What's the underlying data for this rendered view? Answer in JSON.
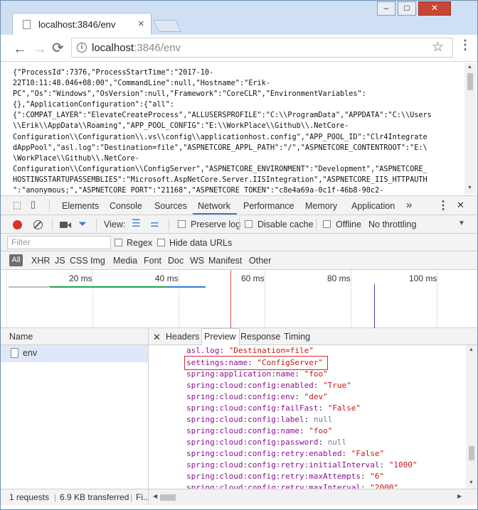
{
  "browser": {
    "tab_title": "localhost:3846/env",
    "tab_close": "×",
    "window_buttons": {
      "minimize": "–",
      "maximize": "□",
      "close": "✕"
    }
  },
  "toolbar": {
    "back": "←",
    "forward": "→",
    "reload": "⟳",
    "url_host": "localhost",
    "url_rest": ":3846/env",
    "star": "☆",
    "menu": "⋮"
  },
  "page": {
    "lines": [
      "{\"ProcessId\":7376,\"ProcessStartTime\":\"2017-10-",
      "22T10:11:48.046+08:00\",\"CommandLine\":null,\"Hostname\":\"Erik-",
      "PC\",\"Os\":\"Windows\",\"OsVersion\":null,\"Framework\":\"CoreCLR\",\"EnvironmentVariables\":",
      "{},\"ApplicationConfiguration\":{\"all\":",
      "{\":COMPAT_LAYER\":\"ElevateCreateProcess\",\"ALLUSERSPROFILE\":\"C:\\\\ProgramData\",\"APPDATA\":\"C:\\\\Users",
      "\\\\Erik\\\\AppData\\\\Roaming\",\"APP_POOL_CONFIG\":\"E:\\\\WorkPlace\\\\Github\\\\.NetCore-",
      "Configuration\\\\Configuration\\\\.vs\\\\config\\\\applicationhost.config\",\"APP_POOL_ID\":\"Clr4Integrate",
      "dAppPool\",\"asl.log\":\"Destination=file\",\"ASPNETCORE_APPL_PATH\":\"/\",\"ASPNETCORE_CONTENTROOT\":\"E:\\",
      "\\WorkPlace\\\\Github\\\\.NetCore-",
      "Configuration\\\\Configuration\\\\ConfigServer\",\"ASPNETCORE_ENVIRONMENT\":\"Development\",\"ASPNETCORE_",
      "HOSTINGSTARTUPASSEMBLIES\":\"Microsoft.AspNetCore.Server.IISIntegration\",\"ASPNETCORE_IIS_HTTPAUTH",
      "\":\"anonymous;\",\"ASPNETCORE_PORT\":\"21168\",\"ASPNETCORE_TOKEN\":\"c8e4a69a-0c1f-46b8-90c2-"
    ]
  },
  "devtools": {
    "tabs": [
      "Elements",
      "Console",
      "Sources",
      "Network",
      "Performance",
      "Memory",
      "Application"
    ],
    "active_tab": "Network",
    "more": "»",
    "kebab": "⋮",
    "close": "✕",
    "network_toolbar": {
      "view_label": "View:",
      "preserve_log": "Preserve log",
      "disable_cache": "Disable cache",
      "offline": "Offline",
      "throttling": "No throttling"
    },
    "filter": {
      "placeholder": "Filter",
      "regex": "Regex",
      "hide_data_urls": "Hide data URLs"
    },
    "type_filters": [
      "All",
      "XHR",
      "JS",
      "CSS",
      "Img",
      "Media",
      "Font",
      "Doc",
      "WS",
      "Manifest",
      "Other"
    ],
    "timeline_ticks": [
      "20 ms",
      "40 ms",
      "60 ms",
      "80 ms",
      "100 ms"
    ],
    "request_list": {
      "header": "Name",
      "rows": [
        "env"
      ]
    },
    "detail_tabs": [
      "Headers",
      "Preview",
      "Response",
      "Timing"
    ],
    "active_detail_tab": "Preview",
    "detail_close": "✕",
    "preview": [
      {
        "key": "asl.log",
        "value": "\"Destination=file\"",
        "kind": "string"
      },
      {
        "key": "settings:name",
        "value": "\"ConfigServer\"",
        "kind": "string"
      },
      {
        "key": "spring:application:name",
        "value": "\"foo\"",
        "kind": "string"
      },
      {
        "key": "spring:cloud:config:enabled",
        "value": "\"True\"",
        "kind": "string"
      },
      {
        "key": "spring:cloud:config:env",
        "value": "\"dev\"",
        "kind": "string"
      },
      {
        "key": "spring:cloud:config:failFast",
        "value": "\"False\"",
        "kind": "string"
      },
      {
        "key": "spring:cloud:config:label",
        "value": "null",
        "kind": "null"
      },
      {
        "key": "spring:cloud:config:name",
        "value": "\"foo\"",
        "kind": "string"
      },
      {
        "key": "spring:cloud:config:password",
        "value": "null",
        "kind": "null"
      },
      {
        "key": "spring:cloud:config:retry:enabled",
        "value": "\"False\"",
        "kind": "string"
      },
      {
        "key": "spring:cloud:config:retry:initialInterval",
        "value": "\"1000\"",
        "kind": "string"
      },
      {
        "key": "spring:cloud:config:retry:maxAttempts",
        "value": "\"6\"",
        "kind": "string"
      },
      {
        "key": "spring:cloud:config:retry:maxInterval",
        "value": "\"2000\"",
        "kind": "string"
      }
    ],
    "highlighted_key": "settings:name",
    "status": {
      "requests": "1 requests",
      "separator": "|",
      "transferred": "6.9 KB transferred",
      "finish": "Fi..."
    }
  },
  "colors": {
    "accent": "#3879d9",
    "record": "#d93025",
    "highlight_box": "#d12c2c"
  }
}
